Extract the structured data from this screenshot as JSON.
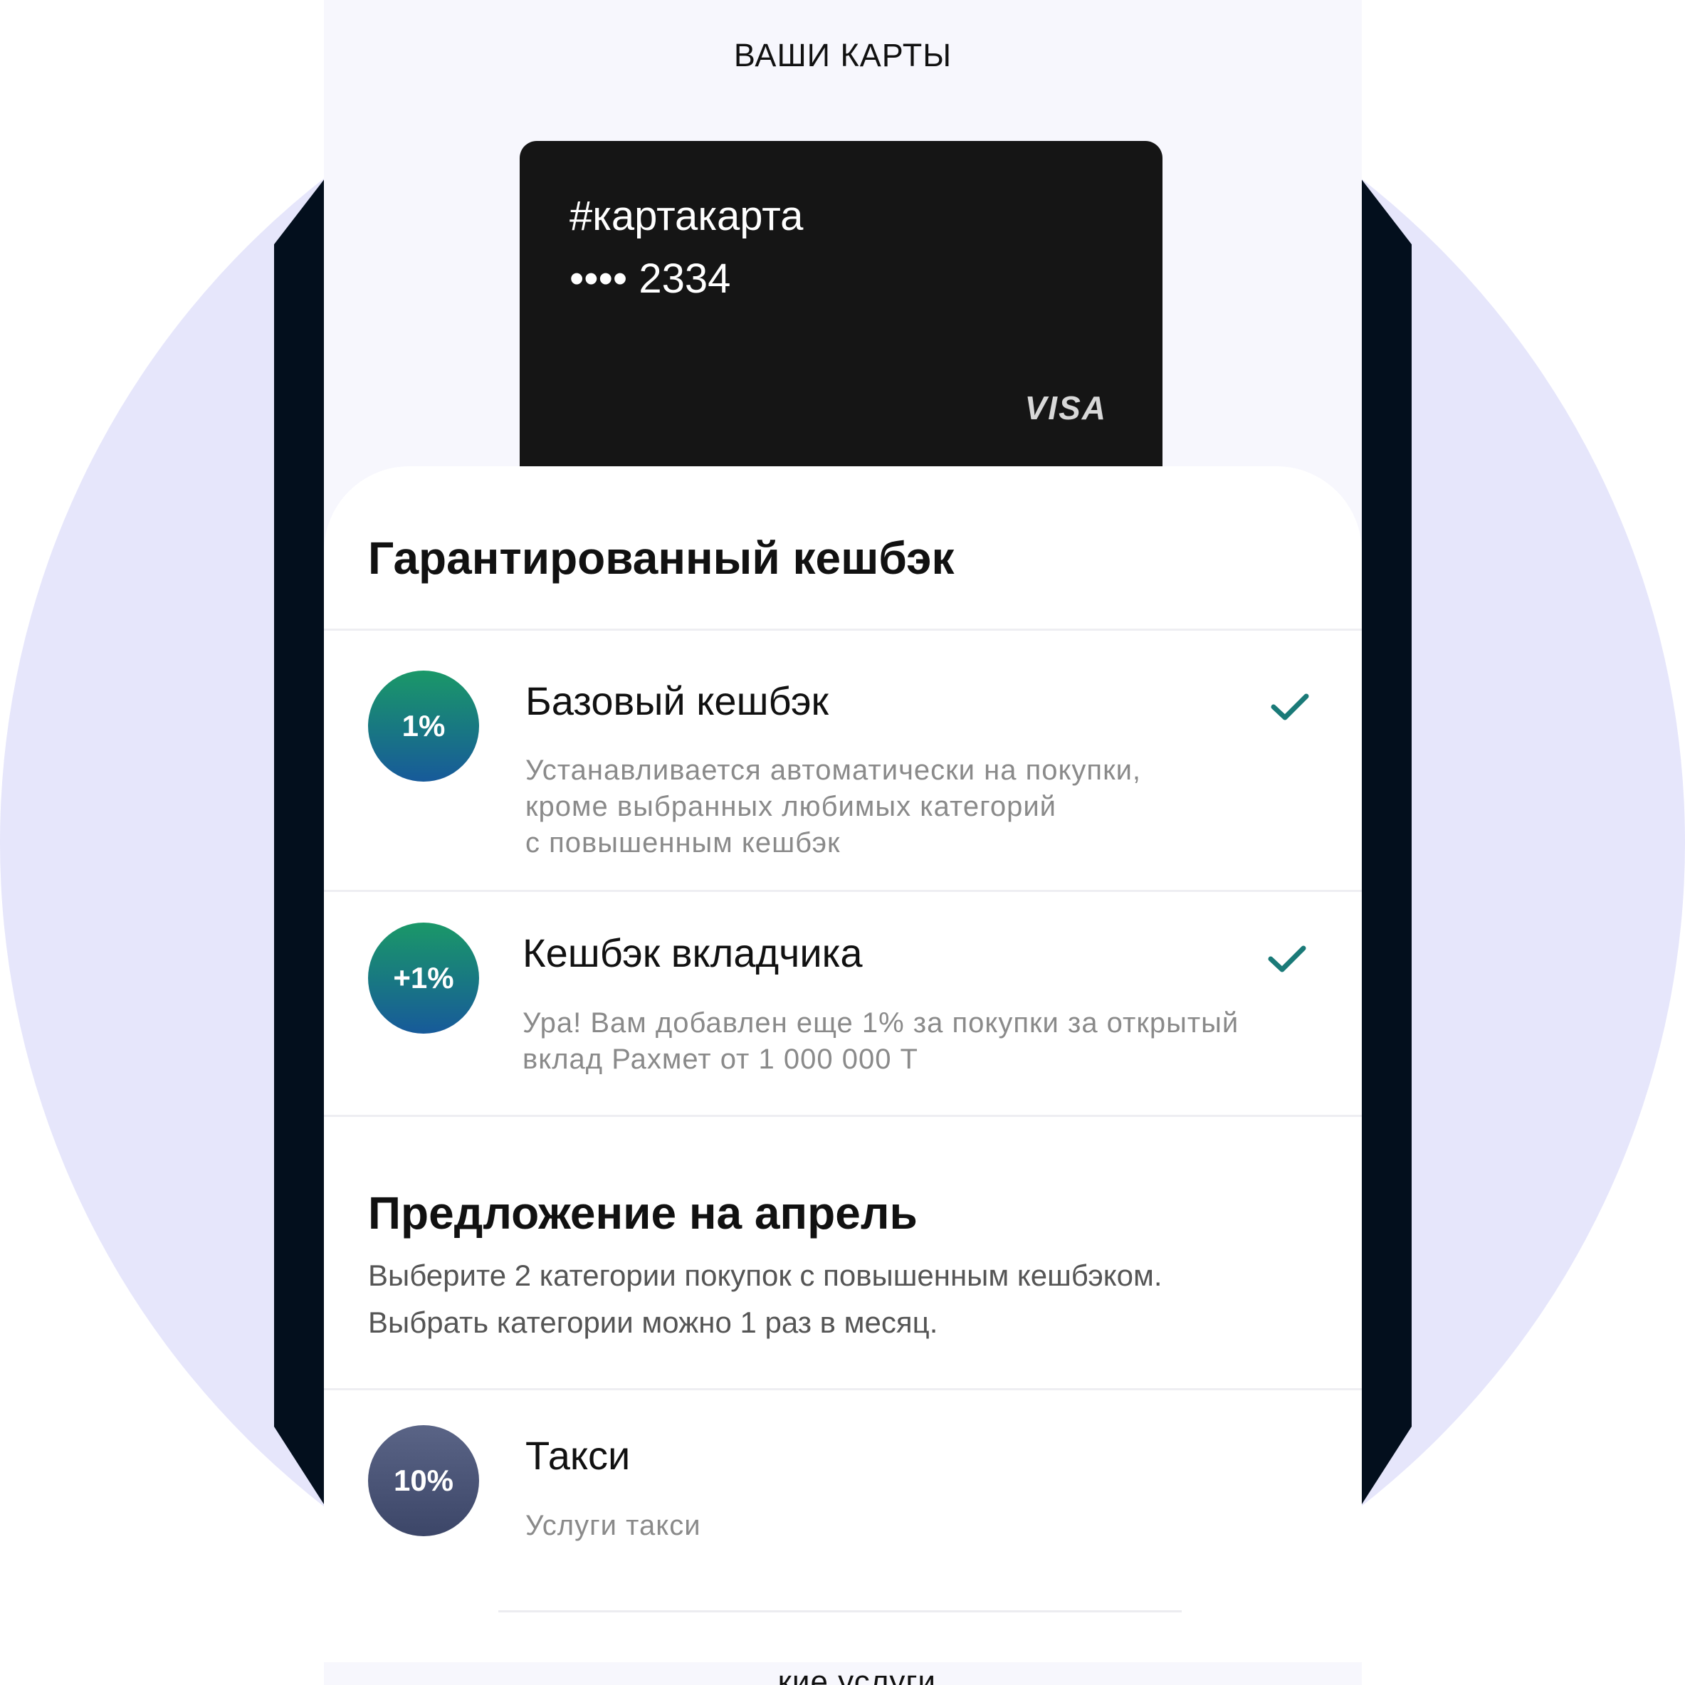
{
  "header": {
    "title": "ВАШИ КАРТЫ"
  },
  "card": {
    "name": "#картакарта",
    "number": "•••• 2334",
    "brand": "VISA"
  },
  "guaranteed": {
    "title": "Гарантированный кешбэк",
    "items": [
      {
        "badge": "1%",
        "title": "Базовый кешбэк",
        "desc": [
          "Устанавливается автоматически на покупки,",
          "кроме выбранных любимых категорий",
          "с повышенным кешбэк"
        ],
        "checked": true
      },
      {
        "badge": "+1%",
        "title": "Кешбэк вкладчика",
        "desc": [
          "Ура! Вам добавлен еще 1% за покупки за открытый",
          "вклад Рахмет от 1 000 000 Т"
        ],
        "checked": true
      }
    ]
  },
  "offer": {
    "title": "Предложение на апрель",
    "desc": [
      "Выберите 2 категории покупок с повышенным кешбэком.",
      "Выбрать категории можно 1 раз в месяц."
    ],
    "items": [
      {
        "badge": "10%",
        "title": "Такси",
        "desc": "Услуги такси"
      }
    ]
  },
  "bottom": {
    "label": "...кие услуги"
  },
  "colors": {
    "accent": "#1a7a78",
    "card": "#151515",
    "background": "#e6e6fb"
  }
}
